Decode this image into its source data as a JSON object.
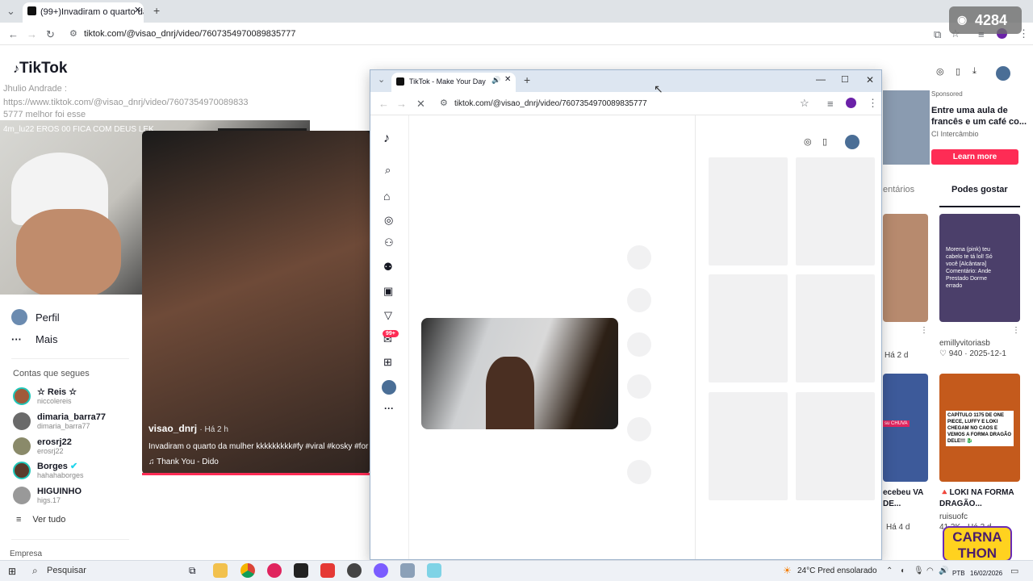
{
  "back_browser": {
    "tab_title": "(99+)Invadiram o quarto da m",
    "url": "tiktok.com/@visao_dnrj/video/7607354970089835777"
  },
  "sidebar": {
    "logo": "TikTok",
    "nav": [
      {
        "label": "Perfil"
      },
      {
        "label": "Mais"
      }
    ],
    "following_header": "Contas que segues",
    "accounts": [
      {
        "name": "☆ Reis ☆",
        "handle": "niccolereis"
      },
      {
        "name": "dimaria_barra77",
        "handle": "dimaria_barra77"
      },
      {
        "name": "erosrj22",
        "handle": "erosrj22"
      },
      {
        "name": "Borges",
        "handle": "hahahaborges"
      },
      {
        "name": "HIGUINHO",
        "handle": "higs.17"
      }
    ],
    "see_all": "Ver tudo",
    "company": "Empresa",
    "chat_line1": "Jhulio Andrade :",
    "chat_line2": "https://www.tiktok.com/@visao_dnrj/video/7607354970089833",
    "chat_line3": "5777 melhor foi esse",
    "chat_line4": "4m_lu22 EROS 00 FICA COM DEUS LEK"
  },
  "back_video": {
    "author": "visao_dnrj",
    "time": "· Há 2 h",
    "description": "Invadiram o quarto da mulher kkkkkkkkk#fy #viral #kosky #for",
    "music": "Thank You - Dido"
  },
  "right_panel": {
    "sponsored": "Sponsored",
    "ad_title": "Entre uma aula de francês e um café co...",
    "ad_brand": "CI Intercâmbio",
    "learn_more": "Learn more",
    "tab_comments": "entários",
    "tab_might_like": "Podes gostar",
    "items": [
      {
        "user": "",
        "time": "Há 2 d"
      },
      {
        "user": "emillyvitoriasb",
        "stats": "♡ 940 · 2025-12-1",
        "overlay": "Morena (pink) teu cabelo te tá lol! Só você [Alcântara] Comentário: Ande Prestado Dorme errado"
      },
      {
        "caption": "ecebeu VA DE...",
        "time": "Há 4 d",
        "overlay": "su CHUVA"
      },
      {
        "caption": "🔺LOKI NA FORMA DRAGÃO...",
        "user": "ruisuofc",
        "stats": "41,3K · Há 3 d",
        "overlay": "CAPÍTULO 1175 DE ONE PIECE, LUFFY E LOKI CHEGAM NO CAOS E VEMOS A FORMA DRAGÃO DELE!!! 🐉"
      }
    ]
  },
  "popup": {
    "tab_title": "TikTok - Make Your Day",
    "url": "tiktok.com/@visao_dnrj/video/7607354970089835777",
    "notif_badge": "99+"
  },
  "taskbar": {
    "search": "Pesquisar",
    "weather_temp": "24°C",
    "weather_desc": "Pred ensolarado",
    "lang": "PTB",
    "date": "16/02/2026"
  },
  "overlays": {
    "viewers": "4284",
    "carnathon": "CARNA THON"
  },
  "colors": {
    "accent": "#fe2c55",
    "text": "#161823"
  }
}
